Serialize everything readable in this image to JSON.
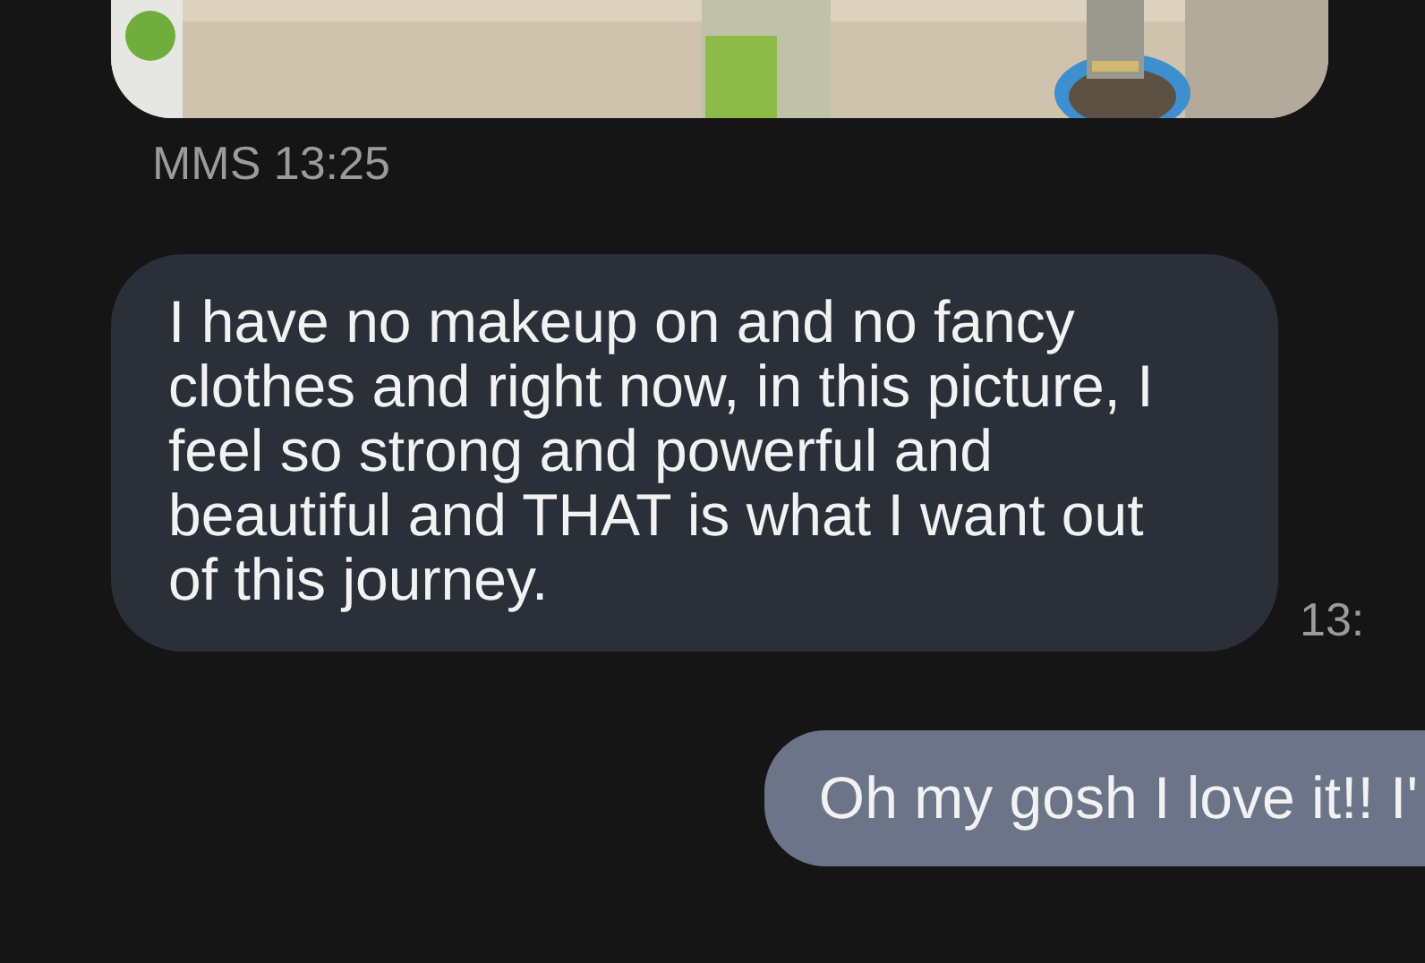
{
  "messages": [
    {
      "kind": "picture",
      "outgoing": false,
      "meta": "MMS 13:25"
    },
    {
      "kind": "text",
      "outgoing": false,
      "text": "I have no makeup on and no fancy clothes and right now, in this picture, I feel so strong and powerful and beautiful and THAT is what I want out of this journey.",
      "time": "13:"
    },
    {
      "kind": "text",
      "outgoing": true,
      "text": "Oh my gosh I love it!! I'"
    }
  ]
}
